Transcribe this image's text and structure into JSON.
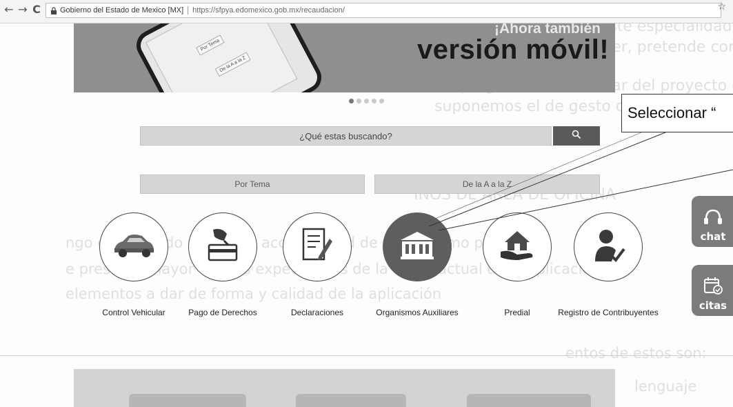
{
  "browser": {
    "back": "←",
    "forward": "→",
    "reload": "C",
    "lock_icon": "🔒",
    "site_identity": "Gobierno del Estado de Mexico [MX]",
    "url": "https://sfpya.edomexico.gob.mx/recaudacion/",
    "star": "☆"
  },
  "banner": {
    "small_text": "¡Ahora también",
    "big_text": "versión móvil!",
    "phone_tile_1": "Por Tema",
    "phone_tile_2": "De la A a la Z",
    "dot_count": 5,
    "active_dot": 0
  },
  "search": {
    "placeholder": "¿Qué estas buscando?"
  },
  "filters": {
    "by_topic": "Por Tema",
    "a_to_z": "De la A a la Z"
  },
  "categories": [
    {
      "label": "Control Vehicular",
      "icon": "car-icon"
    },
    {
      "label": "Pago de Derechos",
      "icon": "payment-card-icon"
    },
    {
      "label": "Declaraciones",
      "icon": "document-pen-icon"
    },
    {
      "label": "Organismos Auxiliares",
      "icon": "building-icon"
    },
    {
      "label": "Predial",
      "icon": "house-hand-icon"
    },
    {
      "label": "Registro de Contribuyentes",
      "icon": "person-check-icon"
    }
  ],
  "callout": {
    "text": "Seleccionar “"
  },
  "side_buttons": {
    "chat": "chat",
    "citas": "citas"
  },
  "background_text": {
    "line1": "en coeficiente. Este especialidad prefiere",
    "line2": "La estrategia: al parecer, pretende considerar de un",
    "line3": "o: dice el preguntas de cambiar del proyecto de componente que ha",
    "line4": "suponemos el de gesto decesivo.",
    "line5": "INOS DE AREA DE OFICINA",
    "line6": "ngo de ilimitado y tener la accesibilidad de su consumo puede si",
    "line7": "e presenta mayor que las expectativas de la cuota actual de la aplicación. Y",
    "line8": "elementos a dar de forma y calidad de la aplicación",
    "line9": "entos de estos son:",
    "line10": "lenguaje"
  },
  "colors": {
    "banner": "#8f8f8f",
    "search_button": "#5a5a5a",
    "highlight_circle": "#5e5e5e",
    "side_button": "#7b7b7b"
  }
}
